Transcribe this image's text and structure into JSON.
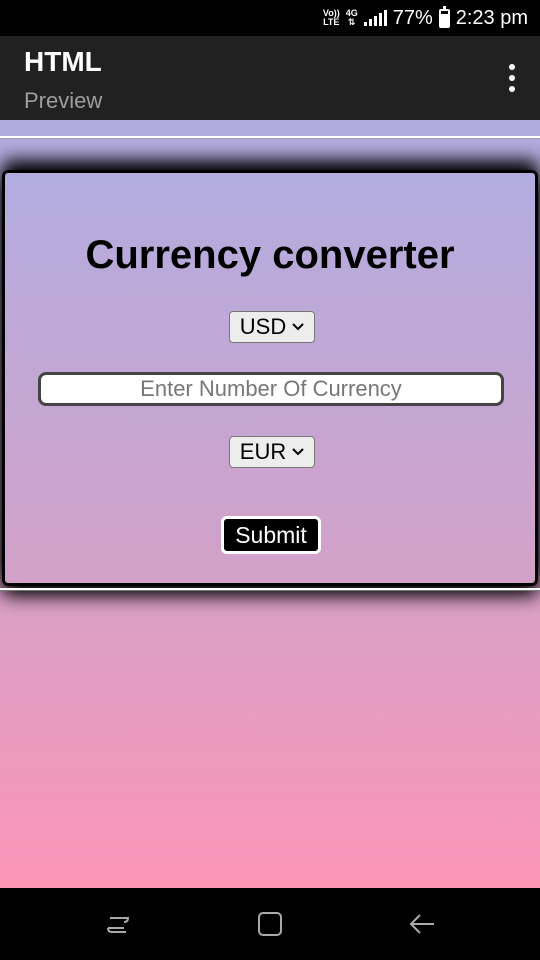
{
  "status_bar": {
    "volte": "Vo)) LTE",
    "network": "4G",
    "battery": "77%",
    "time": "2:23 pm",
    "battery_level": 0.77
  },
  "app_bar": {
    "title": "HTML",
    "subtitle": "Preview",
    "menu_icon": "more-vert-icon"
  },
  "converter": {
    "title": "Currency converter",
    "from_currency": "USD",
    "amount_placeholder": "Enter Number Of Currency",
    "amount_value": "",
    "to_currency": "EUR",
    "submit_label": "Submit"
  },
  "nav_bar": {
    "recents_icon": "recent-apps-icon",
    "home_icon": "home-icon",
    "back_icon": "back-icon"
  },
  "colors": {
    "gradient_top": "#b1acdf",
    "gradient_bottom": "#fb95b6",
    "app_bar": "#212121"
  }
}
